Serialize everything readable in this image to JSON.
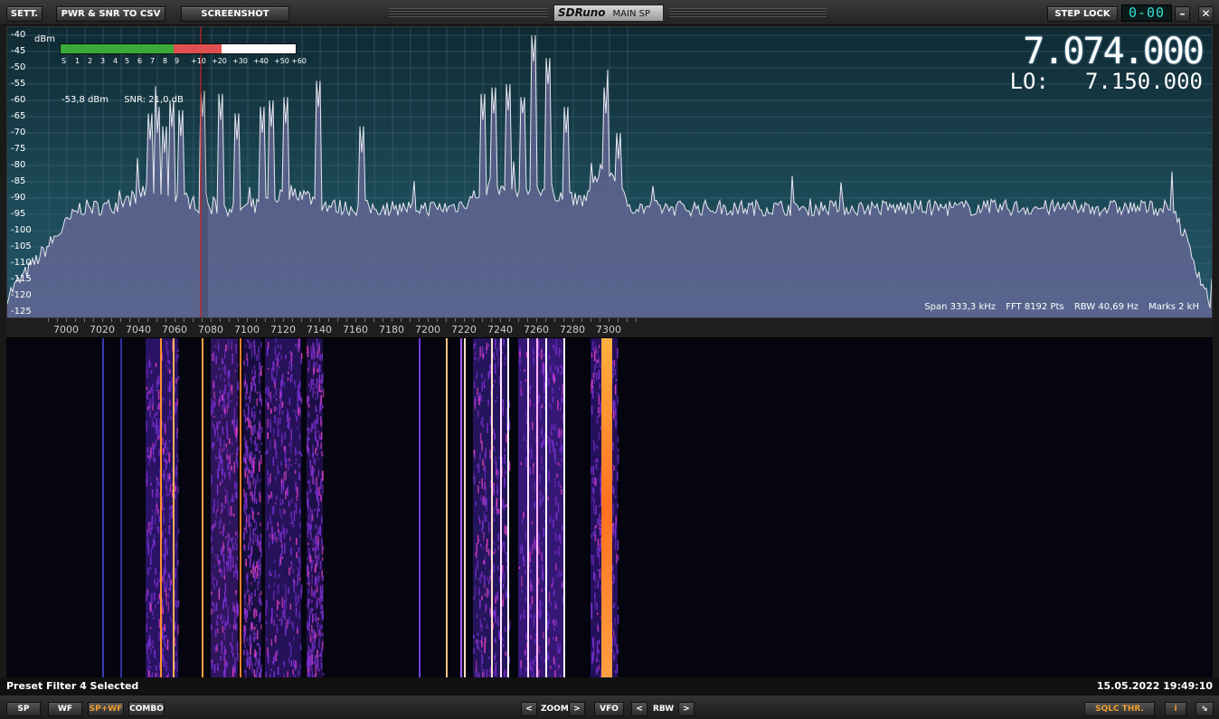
{
  "toolbar": {
    "settings_label": "SETT.",
    "pwr_snr_label": "PWR & SNR TO CSV",
    "screenshot_label": "SCREENSHOT",
    "brand": "SDRuno",
    "window_name": "MAIN SP",
    "step_lock_label": "STEP LOCK",
    "lcd_value": "0-00",
    "minimize_icon": "minimize-icon",
    "close_icon": "close-icon"
  },
  "spectrum": {
    "db_unit": "dBm",
    "db_ticks": [
      "-40",
      "-45",
      "-50",
      "-55",
      "-60",
      "-65",
      "-70",
      "-75",
      "-80",
      "-85",
      "-90",
      "-95",
      "-100",
      "-105",
      "-110",
      "-115",
      "-120",
      "-125"
    ],
    "smeter_ticks": [
      "S",
      "1",
      "2",
      "3",
      "4",
      "5",
      "6",
      "7",
      "8",
      "9",
      "+10",
      "+20",
      "+30",
      "+40",
      "+50",
      "+60"
    ],
    "smeter_level_db": -53.8,
    "level_readout": "-53,8 dBm",
    "snr_readout": "SNR: 21,0 dB",
    "frequency": "7.074.000",
    "lo_label": "LO:",
    "lo_frequency": "7.150.000",
    "span": "Span 333,3 kHz",
    "fft": "FFT 8192 Pts",
    "rbw": "RBW 40,69 Hz",
    "marks": "Marks 2 kH",
    "colors": {
      "trace": "#e8e8f0",
      "fill": "#6a6a9a",
      "marker": "#d02020"
    }
  },
  "freq_axis": {
    "labels": [
      "7000",
      "7020",
      "7040",
      "7060",
      "7080",
      "7100",
      "7120",
      "7140",
      "7160",
      "7180",
      "7200",
      "7220",
      "7240",
      "7260",
      "7280",
      "7300"
    ],
    "marker_khz": 7074
  },
  "status": {
    "left": "Preset Filter 4 Selected",
    "right": "15.05.2022 19:49:10"
  },
  "bottombar": {
    "sp_label": "SP",
    "wf_label": "WF",
    "spwf_label": "SP+WF",
    "combo_label": "COMBO",
    "zoom_prev": "<",
    "zoom_label": "ZOOM",
    "zoom_next": ">",
    "vfo_label": "VFO",
    "rbw_prev": "<",
    "rbw_label": "RBW",
    "rbw_next": ">",
    "sqlc_label": "SQLC THR.",
    "info_label": "i",
    "resize_icon": "resize-icon"
  }
}
